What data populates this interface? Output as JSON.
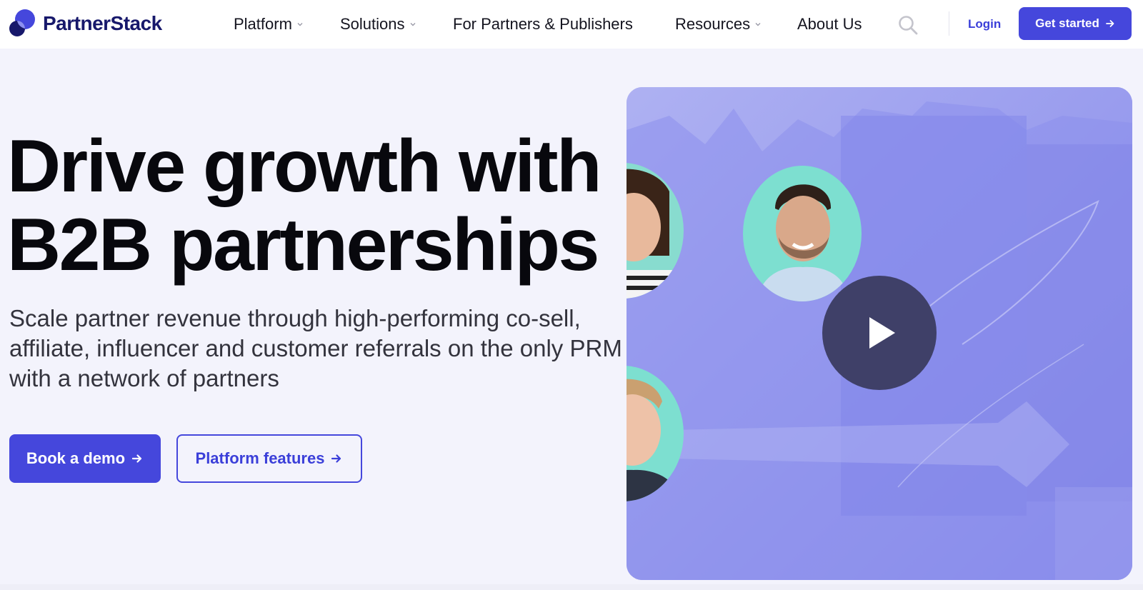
{
  "brand": {
    "name": "PartnerStack",
    "color": "#17186b",
    "accent": "#4547dc"
  },
  "nav": {
    "items": [
      {
        "label": "Platform",
        "has_dropdown": true
      },
      {
        "label": "Solutions",
        "has_dropdown": true
      },
      {
        "label": "For Partners & Publishers",
        "has_dropdown": false
      },
      {
        "label": "Resources",
        "has_dropdown": true
      },
      {
        "label": "About Us",
        "has_dropdown": false
      }
    ],
    "search_icon": "search-icon",
    "login_label": "Login",
    "get_started_label": "Get started"
  },
  "hero": {
    "headline_line1": "Drive growth with",
    "headline_line2": "B2B partnerships",
    "subtext": "Scale partner revenue through high-performing co-sell, affiliate, influencer and customer referrals on the only PRM with a network of partners",
    "primary_cta": "Book a demo",
    "secondary_cta": "Platform features"
  },
  "video": {
    "play_icon": "play-icon",
    "background_color": "#9396ec",
    "avatar_ring_color": "#7ddfd0"
  }
}
